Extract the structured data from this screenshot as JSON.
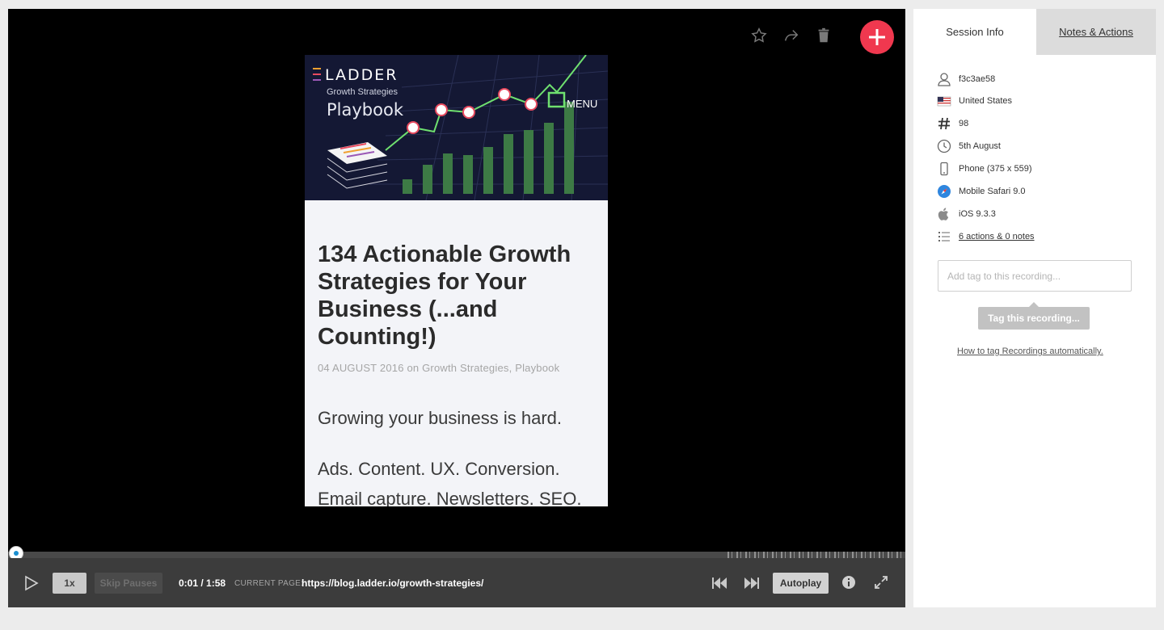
{
  "player": {
    "top_actions": [
      "star-icon",
      "share-icon",
      "trash-icon",
      "add-icon"
    ],
    "accent_color": "#f0384f"
  },
  "recording": {
    "hero": {
      "logo": "LADDER",
      "subtitle": "Growth Strategies",
      "title": "Playbook",
      "menu_label": "MENU"
    },
    "article": {
      "title": "134 Actionable Growth Strategies for Your Business (...and Counting!)",
      "date": "04 AUGUST 2016",
      "on": "on",
      "tag1": "Growth Strategies",
      "sep": ",",
      "tag2": "Playbook",
      "para1": "Growing your business is hard.",
      "para2": "Ads. Content. UX. Conversion. Email capture. Newsletters. SEO."
    }
  },
  "controls": {
    "speed": "1x",
    "skip_pauses": "Skip Pauses",
    "time": "0:01 / 1:58",
    "current_page_label": "CURRENT PAGE:",
    "current_page_url": "https://blog.ladder.io/growth-strategies/",
    "autoplay": "Autoplay"
  },
  "sidebar": {
    "tabs": {
      "session": "Session Info",
      "notes": "Notes & Actions"
    },
    "info": {
      "user_id": "f3c3ae58",
      "country": "United States",
      "number": "98",
      "date": "5th August",
      "device": "Phone (375 x 559)",
      "browser": "Mobile Safari 9.0",
      "os": "iOS 9.3.3",
      "actions_link": "6 actions & 0 notes"
    },
    "tag_placeholder": "Add tag to this recording...",
    "tag_tooltip": "Tag this recording...",
    "auto_tag_link": "How to tag Recordings automatically."
  }
}
